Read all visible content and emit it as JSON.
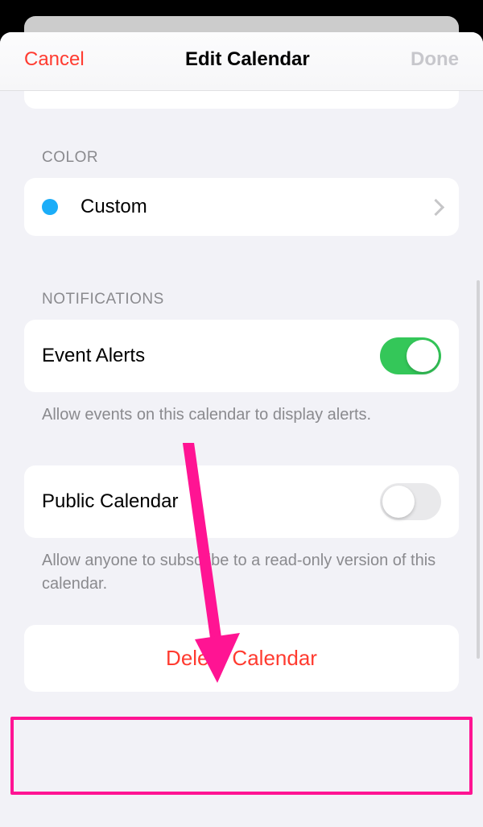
{
  "nav": {
    "cancel": "Cancel",
    "title": "Edit Calendar",
    "done": "Done"
  },
  "color_section": {
    "header": "COLOR",
    "label": "Custom",
    "swatch": "#1badf8"
  },
  "notifications_section": {
    "header": "NOTIFICATIONS",
    "event_alerts_label": "Event Alerts",
    "event_alerts_on": true,
    "footer": "Allow events on this calendar to display alerts."
  },
  "public_section": {
    "label": "Public Calendar",
    "public_on": false,
    "footer": "Allow anyone to subscribe to a read-only version of this calendar."
  },
  "delete": {
    "label": "Delete Calendar"
  },
  "annotation": {
    "arrow_color": "#ff1493",
    "highlight_color": "#ff1493"
  }
}
